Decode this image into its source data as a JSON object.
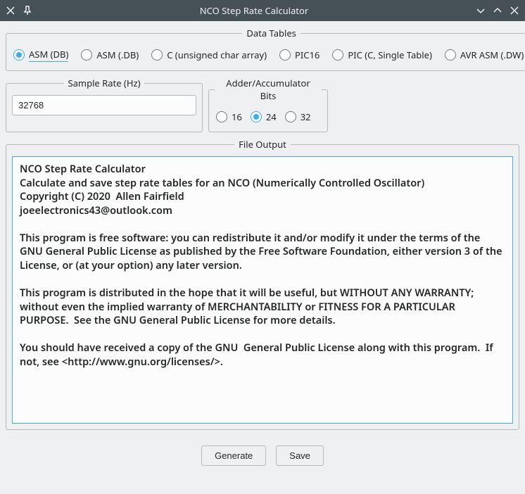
{
  "window": {
    "title": "NCO Step Rate Calculator"
  },
  "data_tables": {
    "legend": "Data Tables",
    "options": [
      "ASM (DB)",
      "ASM (.DB)",
      "C (unsigned char array)",
      "PIC16",
      "PIC (C, Single Table)",
      "AVR ASM (.DW)"
    ],
    "selected_index": 0
  },
  "sample_rate": {
    "legend": "Sample Rate (Hz)",
    "value": "32768"
  },
  "bits": {
    "legend": "Adder/Accumulator Bits",
    "options": [
      "16",
      "24",
      "32"
    ],
    "selected_index": 1
  },
  "file_output": {
    "legend": "File Output",
    "text": "NCO Step Rate Calculator\nCalculate and save step rate tables for an NCO (Numerically Controlled Oscillator)\nCopyright (C) 2020  Allen Fairfield\njoeelectronics43@outlook.com\n\nThis program is free software: you can redistribute it and/or modify it under the terms of the GNU General Public License as published by the Free Software Foundation, either version 3 of the License, or (at your option) any later version.\n\nThis program is distributed in the hope that it will be useful, but WITHOUT ANY WARRANTY; without even the implied warranty of MERCHANTABILITY or FITNESS FOR A PARTICULAR PURPOSE.  See the GNU General Public License for more details.\n\nYou should have received a copy of the GNU  General Public License along with this program.  If not, see <http://www.gnu.org/licenses/>."
  },
  "buttons": {
    "generate": "Generate",
    "save": "Save"
  }
}
